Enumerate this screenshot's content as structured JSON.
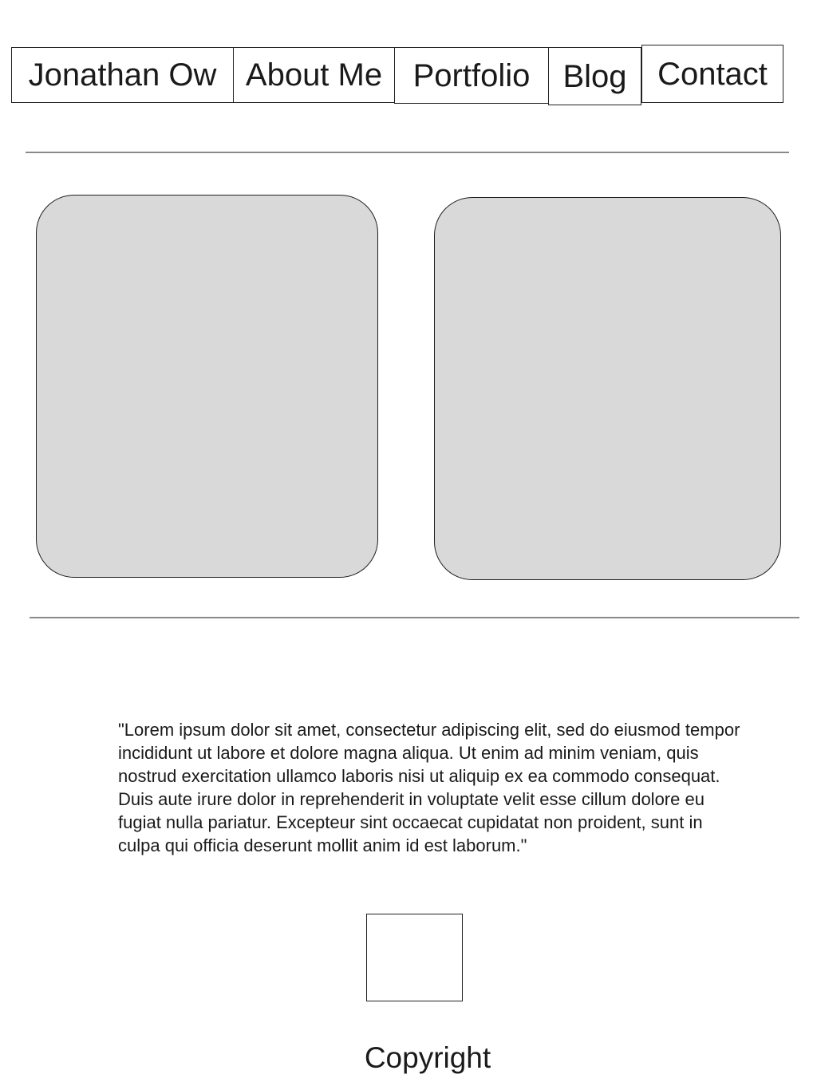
{
  "nav": {
    "name": "Jonathan Ow",
    "about": "About Me",
    "portfolio": "Portfolio",
    "blog": "Blog",
    "contact": "Contact"
  },
  "quote": {
    "text": "\"Lorem ipsum dolor sit amet, consectetur adipiscing elit, sed do eiusmod tempor incididunt ut labore et dolore magna aliqua. Ut enim ad minim veniam, quis nostrud exercitation ullamco laboris nisi ut aliquip ex ea commodo consequat. Duis aute irure dolor in reprehenderit in voluptate velit esse cillum dolore eu fugiat nulla pariatur. Excepteur sint occaecat cupidatat non proident, sunt in culpa qui officia deserunt mollit anim id est laborum.\""
  },
  "footer": {
    "copyright": "Copyright"
  },
  "colors": {
    "card_fill": "#d9d9d9",
    "divider": "#8a8a8a",
    "border": "#222222",
    "background": "#ffffff"
  }
}
